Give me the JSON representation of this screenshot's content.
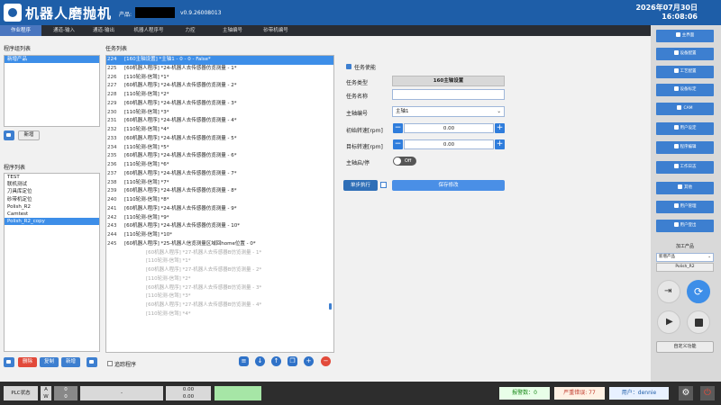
{
  "header": {
    "title": "机器人磨抛机",
    "product_label": "产品:",
    "version": "v0.9.26008013",
    "date": "2026年07月30日",
    "time": "16:08:06"
  },
  "tabs": [
    "作业程序",
    "通道-输入",
    "通道-输出",
    "机器人程序号",
    "力控",
    "主轴编号",
    "砂带机编号"
  ],
  "left": {
    "group_title": "程序组列表",
    "groups": [
      "新增产品"
    ],
    "new_label": "新增",
    "program_title": "程序列表",
    "programs": [
      "TEST",
      "联机测试",
      "刀具库定位",
      "砂带机定位",
      "Polish_R2",
      "Camtest",
      "Polish_R2_copy"
    ],
    "delete_label": "删除",
    "copy_label": "复制",
    "new2_label": "新增"
  },
  "tasks": {
    "title": "任务列表",
    "trace_label": "追踪程序",
    "rows": [
      {
        "n": "224",
        "t": "[160主轴设置]   *主轴1 - 0 - 0 - False*"
      },
      {
        "n": "225",
        "t": "[60机器人程序]   *24-机器人去传感器仿览测量 - 1*"
      },
      {
        "n": "226",
        "t": "[110轮测-信驾]   *1*"
      },
      {
        "n": "227",
        "t": "[60机器人程序]   *24-机器人去传感器仿览测量 - 2*"
      },
      {
        "n": "228",
        "t": "[110轮测-信驾]   *2*"
      },
      {
        "n": "229",
        "t": "[60机器人程序]   *24-机器人去传感器仿览测量 - 3*"
      },
      {
        "n": "230",
        "t": "[110轮测-信驾]   *3*"
      },
      {
        "n": "231",
        "t": "[60机器人程序]   *24-机器人去传感器仿览测量 - 4*"
      },
      {
        "n": "232",
        "t": "[110轮测-信驾]   *4*"
      },
      {
        "n": "233",
        "t": "[60机器人程序]   *24-机器人去传感器仿览测量 - 5*"
      },
      {
        "n": "234",
        "t": "[110轮测-信驾]   *5*"
      },
      {
        "n": "235",
        "t": "[60机器人程序]   *24-机器人去传感器仿览测量 - 6*"
      },
      {
        "n": "236",
        "t": "[110轮测-信驾]   *6*"
      },
      {
        "n": "237",
        "t": "[60机器人程序]   *24-机器人去传感器仿览测量 - 7*"
      },
      {
        "n": "238",
        "t": "[110轮测-信驾]   *7*"
      },
      {
        "n": "239",
        "t": "[60机器人程序]   *24-机器人去传感器仿览测量 - 8*"
      },
      {
        "n": "240",
        "t": "[110轮测-信驾]   *8*"
      },
      {
        "n": "241",
        "t": "[60机器人程序]   *24-机器人去传感器仿览测量 - 9*"
      },
      {
        "n": "242",
        "t": "[110轮测-信驾]   *9*"
      },
      {
        "n": "243",
        "t": "[60机器人程序]   *24-机器人去传感器仿览测量 - 10*"
      },
      {
        "n": "244",
        "t": "[110轮测-信驾]   *10*"
      },
      {
        "n": "245",
        "t": "[60机器人程序]   *25-机器人信览测量区域回home位置 - 0*"
      },
      {
        "n": "",
        "t": "[60机器人程序]   *27-机器人去传感器B仿览测量 - 1*"
      },
      {
        "n": "",
        "t": "[110轮测-信驾]   *1*"
      },
      {
        "n": "",
        "t": "[60机器人程序]   *27-机器人去传感器B仿览测量 - 2*"
      },
      {
        "n": "",
        "t": "[110轮测-信驾]   *2*"
      },
      {
        "n": "",
        "t": "[60机器人程序]   *27-机器人去传感器B仿览测量 - 3*"
      },
      {
        "n": "",
        "t": "[110轮测-信驾]   *3*"
      },
      {
        "n": "",
        "t": "[60机器人程序]   *27-机器人去传感器B仿览测量 - 4*"
      },
      {
        "n": "",
        "t": "[110轮测-信驾]   *4*"
      }
    ]
  },
  "form": {
    "enable_label": "任务使能",
    "type_label": "任务类型",
    "type_value": "160主轴设置",
    "name_label": "任务名称",
    "name_value": "",
    "spindle_label": "主轴编号",
    "spindle_value": "主轴1",
    "init_speed_label": "初始转速[rpm]",
    "init_speed_value": "0.00",
    "target_speed_label": "目标转速[rpm]",
    "target_speed_value": "0.00",
    "start_label": "主轴启/停",
    "toggle_label": "Off",
    "step_label": "单步执行",
    "save_label": "保存修改"
  },
  "sidebar": {
    "buttons": [
      "主界面",
      "设备配置",
      "工艺配置",
      "设备标定",
      "CAM",
      "用户设定",
      "程序编辑",
      "工作日志",
      "其他",
      "用户管理",
      "用户登出"
    ],
    "product_title": "加工产品",
    "product_select": "新增产品",
    "product_program": "Polish_R2",
    "custom_label": "自定义功能"
  },
  "status": {
    "plc_label": "PLC状态",
    "a_label": "A",
    "w_label": "W",
    "zero1": "0",
    "zero2": "0",
    "dash": "-",
    "val1": "0.00",
    "val2": "0.00",
    "alarm": "报警数：0",
    "error": "严重错误: 77",
    "user": "用户：dennie"
  },
  "colors": {
    "primary": "#1e5ea8",
    "accent": "#3d7fd0",
    "danger": "#e24a3a",
    "selected": "#3d8ee8"
  }
}
